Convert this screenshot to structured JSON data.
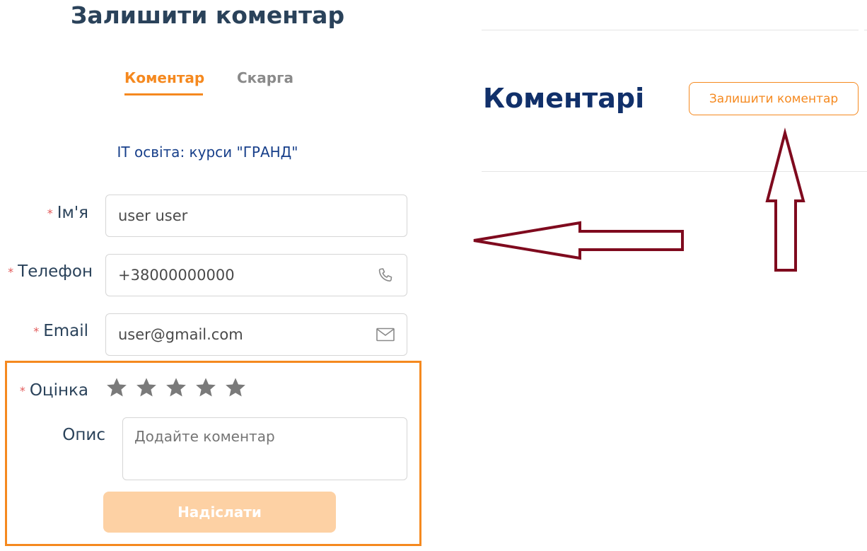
{
  "modal": {
    "title": "Залишити коментар",
    "tabs": [
      {
        "label": "Коментар",
        "active": true
      },
      {
        "label": "Скарга",
        "active": false
      }
    ],
    "course_name": "IT освіта: курси \"ГРАНД\""
  },
  "form": {
    "required_mark": "*",
    "name": {
      "label": "Ім'я",
      "value": "user user"
    },
    "phone": {
      "label": "Телефон",
      "value": "+38000000000",
      "icon": "phone-icon"
    },
    "email": {
      "label": "Email",
      "value": "user@gmail.com",
      "icon": "mail-icon"
    },
    "rating": {
      "label": "Оцінка",
      "max": 5,
      "value": 0,
      "icon": "star-icon"
    },
    "description": {
      "label": "Опис",
      "placeholder": "Додайте коментар"
    },
    "submit_label": "Надіслати"
  },
  "comments": {
    "title": "Коментарі",
    "leave_comment_label": "Залишити коментар"
  },
  "colors": {
    "accent": "#f5891f",
    "heading": "#2a425a",
    "link": "#173f8a",
    "arrow": "#7f0a1e",
    "submit_disabled": "#fdd1a4"
  }
}
